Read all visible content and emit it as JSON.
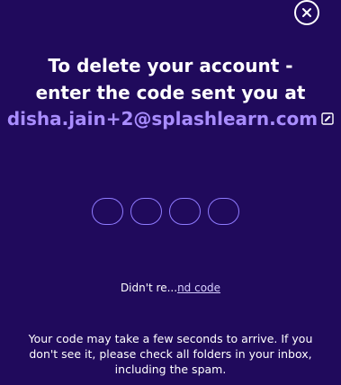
{
  "close_button": {
    "icon": "close-icon"
  },
  "heading": {
    "line1": "To delete your account -",
    "line2": "enter the code sent you at"
  },
  "email": "disha.jain+2@splashlearn.com",
  "edit_icon": "edit-icon",
  "otp": {
    "boxes": [
      "",
      "",
      "",
      ""
    ]
  },
  "resend": {
    "prefix": "Didn't re...",
    "link": "nd code"
  },
  "info": {
    "line1": "Your code may take a few seconds to arrive. If you",
    "line2": "don't see it, please check all folders in your inbox,",
    "line3": "including the spam."
  },
  "colors": {
    "background": "#200a5c",
    "accent": "#a98dff",
    "otp_border": "#8f7bff",
    "text": "#ffffff"
  }
}
